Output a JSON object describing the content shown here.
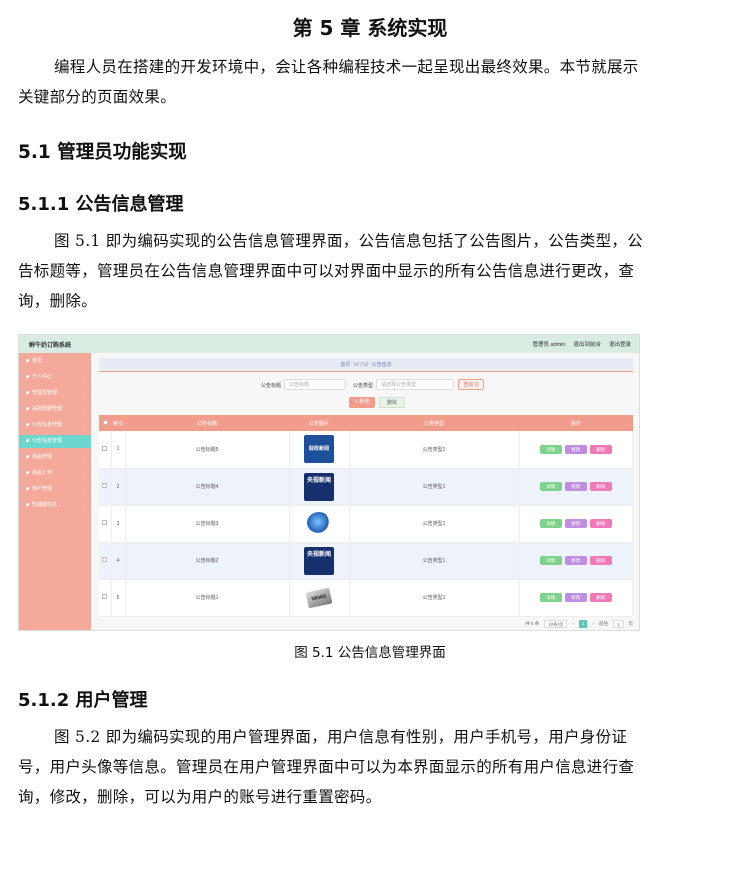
{
  "chapter_title": "第 5 章  系统实现",
  "intro": "编程人员在搭建的开发环境中，会让各种编程技术一起呈现出最终效果。本节就展示关键部分的页面效果。",
  "section_5_1": "5.1  管理员功能实现",
  "section_5_1_1": "5.1.1  公告信息管理",
  "para_5_1_1": "图 5.1 即为编码实现的公告信息管理界面，公告信息包括了公告图片，公告类型，公告标题等，管理员在公告信息管理界面中可以对界面中显示的所有公告信息进行更改，查询，删除。",
  "figure": {
    "brand": "鲜牛奶订购系统",
    "topbar_links": [
      "管理员 admin",
      "退出到前台",
      "退出登录"
    ],
    "sidebar_items": [
      {
        "label": "首页",
        "active": false,
        "has_arrow": false
      },
      {
        "label": "个人中心",
        "active": false,
        "has_arrow": true
      },
      {
        "label": "管理员管理",
        "active": false,
        "has_arrow": true
      },
      {
        "label": "基础数据管理",
        "active": false,
        "has_arrow": true
      },
      {
        "label": "公告信息管理",
        "active": false,
        "has_arrow": true
      },
      {
        "label": "公告信息管理",
        "active": true,
        "has_arrow": false
      },
      {
        "label": "商品管理",
        "active": false,
        "has_arrow": true
      },
      {
        "label": "商品订单",
        "active": false,
        "has_arrow": true
      },
      {
        "label": "用户管理",
        "active": false,
        "has_arrow": true
      },
      {
        "label": "轮播图信息",
        "active": false,
        "has_arrow": true
      }
    ],
    "breadcrumb": "首页（o'▽'o）公告信息",
    "search": {
      "title_label": "公告标题",
      "title_placeholder": "公告标题",
      "type_label": "公告类型",
      "type_placeholder": "请选择公告类型",
      "search_button": "查询 Q"
    },
    "add_button": "+ 新增",
    "delete_button": "删除",
    "table": {
      "headers": [
        "索引",
        "公告标题",
        "公告图片",
        "公告类型",
        "操作"
      ],
      "rows": [
        {
          "index": "1",
          "title": "公告标题5",
          "type": "公告类型2",
          "thumb": "财政新闻"
        },
        {
          "index": "2",
          "title": "公告标题4",
          "type": "公告类型1",
          "thumb": "央视新闻"
        },
        {
          "index": "3",
          "title": "公告标题3",
          "type": "公告类型1",
          "thumb": ""
        },
        {
          "index": "4",
          "title": "公告标题2",
          "type": "公告类型1",
          "thumb": "央视新闻"
        },
        {
          "index": "5",
          "title": "公告标题1",
          "type": "公告类型1",
          "thumb": "NEWS"
        }
      ],
      "op_labels": [
        "详情",
        "修改",
        "删除"
      ]
    },
    "pager": {
      "total": "共 5 条",
      "size": "10条/页",
      "current": "1",
      "goto": "前往",
      "page_input": "1",
      "page_suffix": "页"
    }
  },
  "figure_caption": "图 5.1 公告信息管理界面",
  "section_5_1_2": "5.1.2  用户管理",
  "para_5_1_2": "图 5.2 即为编码实现的用户管理界面，用户信息有性别，用户手机号，用户身份证号，用户头像等信息。管理员在用户管理界面中可以为本界面显示的所有用户信息进行查询，修改，删除，可以为用户的账号进行重置密码。",
  "colors": {
    "sidebar": "#f4a99b",
    "active_item": "#6dd6cf",
    "header_row": "#f29c8c",
    "topbar": "#d9ece1"
  }
}
